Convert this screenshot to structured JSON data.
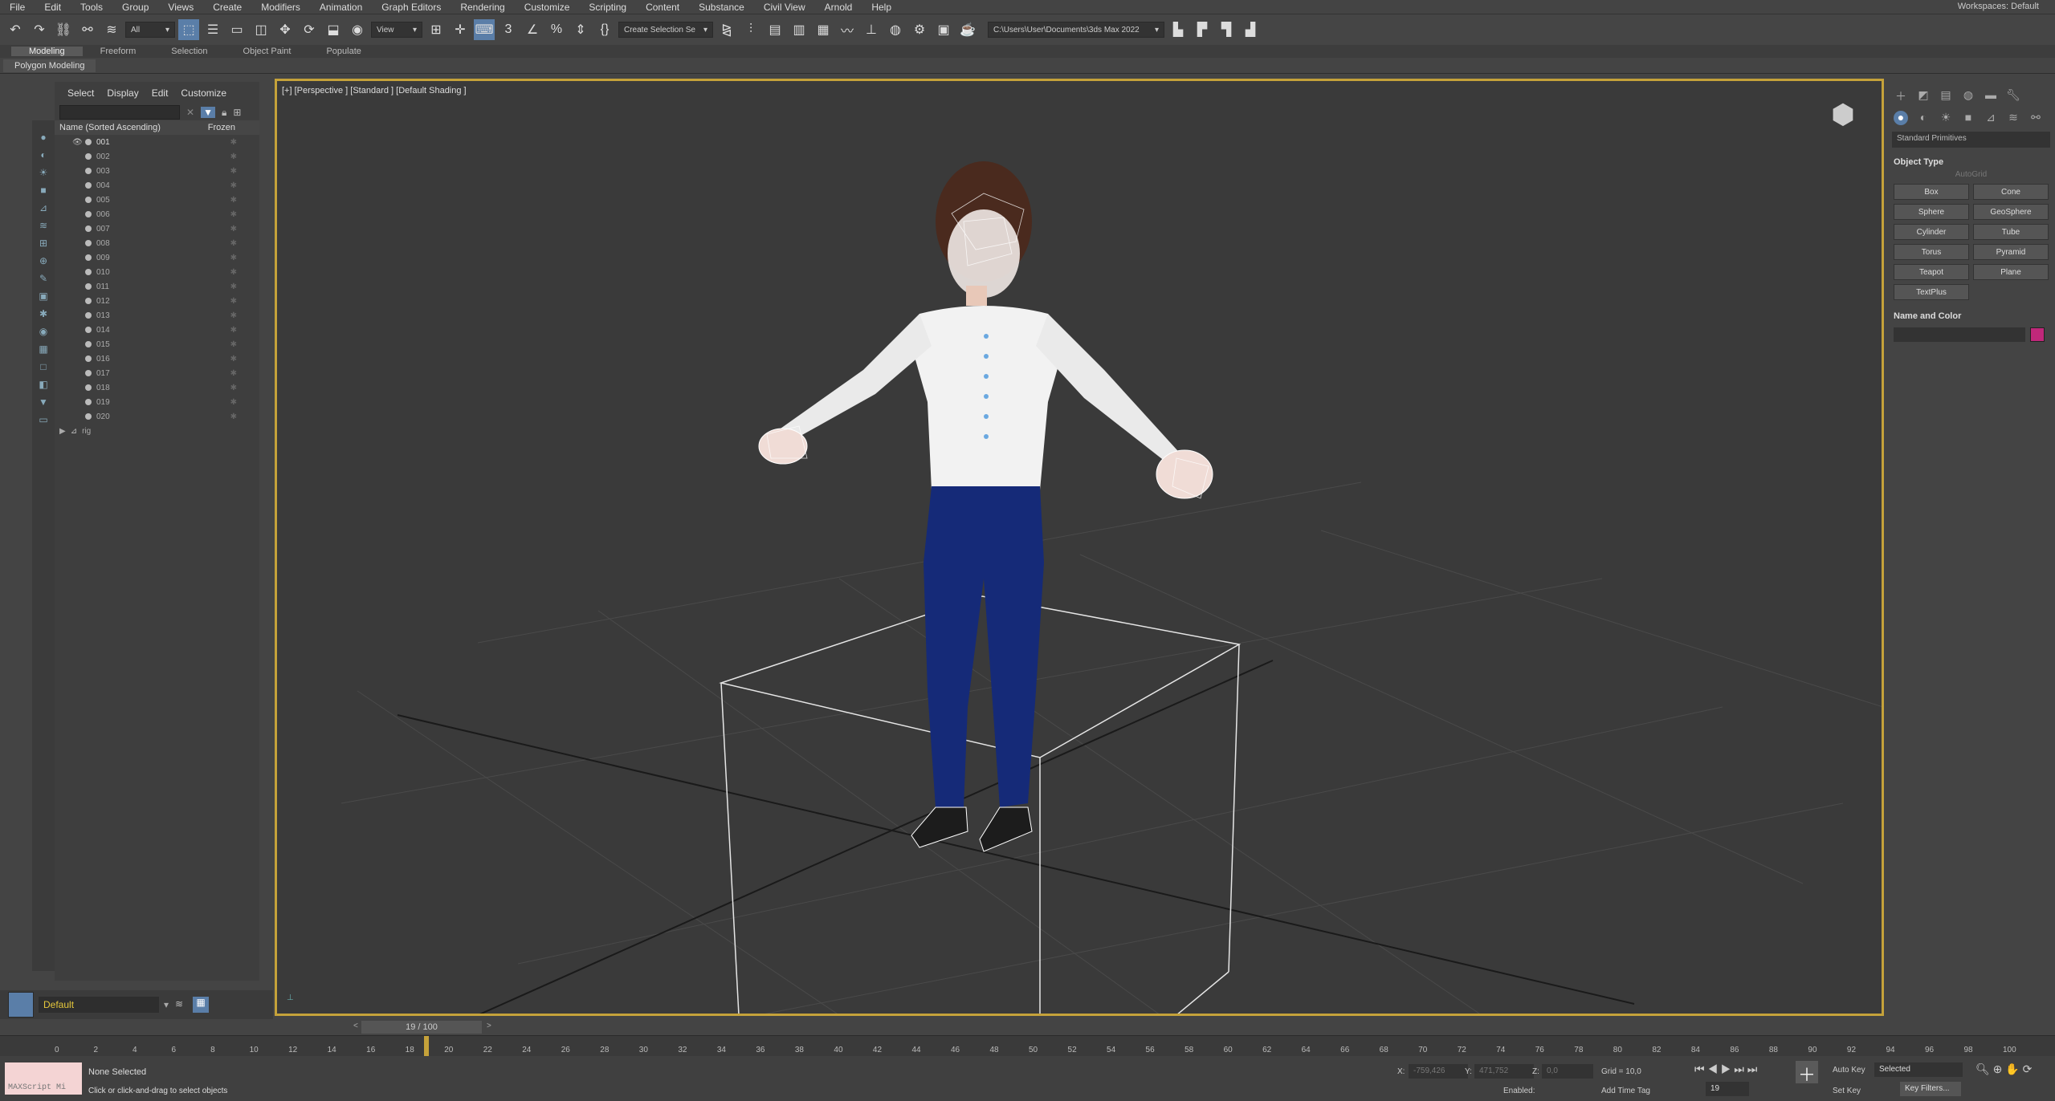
{
  "menu": [
    "File",
    "Edit",
    "Tools",
    "Group",
    "Views",
    "Create",
    "Modifiers",
    "Animation",
    "Graph Editors",
    "Rendering",
    "Customize",
    "Scripting",
    "Content",
    "Substance",
    "Civil View",
    "Arnold",
    "Help"
  ],
  "workspace": "Workspaces: Default",
  "toolbar": {
    "filter_label": "All",
    "refcoord_label": "View",
    "selection_set": "Create Selection Se",
    "project_path": "C:\\Users\\User\\Documents\\3ds Max 2022"
  },
  "ribbon": {
    "tabs": [
      "Modeling",
      "Freeform",
      "Selection",
      "Object Paint",
      "Populate"
    ],
    "panel": "Polygon Modeling"
  },
  "scene": {
    "tabs": [
      "Select",
      "Display",
      "Edit",
      "Customize"
    ],
    "col_name": "Name (Sorted Ascending)",
    "col_frozen": "Frozen",
    "items": [
      "001",
      "002",
      "003",
      "004",
      "005",
      "006",
      "007",
      "008",
      "009",
      "010",
      "011",
      "012",
      "013",
      "014",
      "015",
      "016",
      "017",
      "018",
      "019",
      "020"
    ],
    "rig": "rig"
  },
  "layer": "Default",
  "viewport": {
    "label": "[+] [Perspective ] [Standard ] [Default Shading ]"
  },
  "command_panel": {
    "dropdown": "Standard Primitives",
    "object_type": "Object Type",
    "autogrid": "AutoGrid",
    "buttons": [
      "Box",
      "Cone",
      "Sphere",
      "GeoSphere",
      "Cylinder",
      "Tube",
      "Torus",
      "Pyramid",
      "Teapot",
      "Plane",
      "TextPlus"
    ],
    "name_color": "Name and Color",
    "color": "#c0287a"
  },
  "timeline": {
    "frame": "19 / 100",
    "ticks": [
      "0",
      "2",
      "4",
      "6",
      "8",
      "10",
      "12",
      "14",
      "16",
      "18",
      "20",
      "22",
      "24",
      "26",
      "28",
      "30",
      "32",
      "34",
      "36",
      "38",
      "40",
      "42",
      "44",
      "46",
      "48",
      "50",
      "52",
      "54",
      "56",
      "58",
      "60",
      "62",
      "64",
      "66",
      "68",
      "70",
      "72",
      "74",
      "76",
      "78",
      "80",
      "82",
      "84",
      "86",
      "88",
      "90",
      "92",
      "94",
      "96",
      "98",
      "100"
    ]
  },
  "status": {
    "maxscript": "MAXScript Mi",
    "selection": "None Selected",
    "prompt": "Click or click-and-drag to select objects",
    "x_label": "X:",
    "x": "-759,426",
    "y_label": "Y:",
    "y": "471,752",
    "z_label": "Z:",
    "z": "0,0",
    "grid": "Grid = 10,0",
    "enabled": "Enabled:",
    "add_time_tag": "Add Time Tag",
    "auto_key": "Auto Key",
    "set_key": "Set Key",
    "key_mode": "Selected",
    "key_filters": "Key Filters...",
    "current_frame": "19"
  }
}
